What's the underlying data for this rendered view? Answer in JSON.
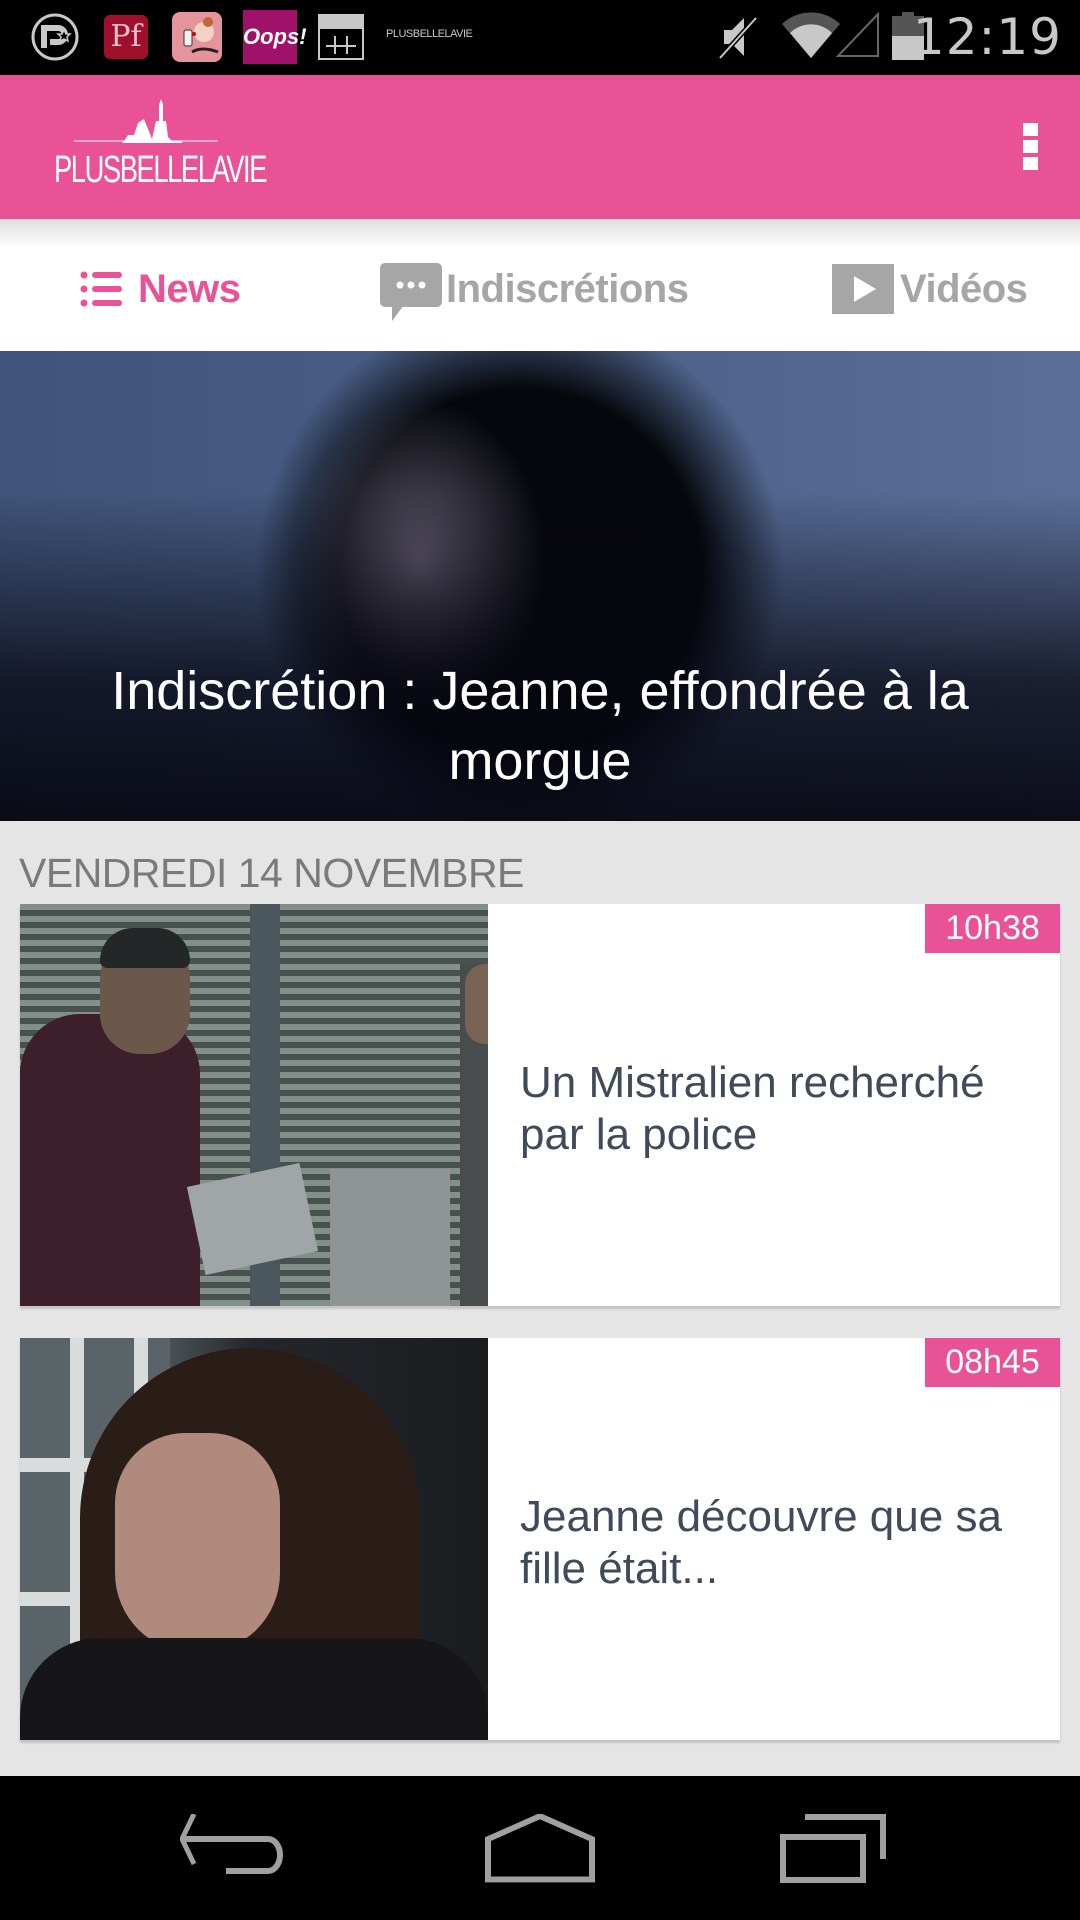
{
  "status_bar": {
    "notification_icons": [
      "pinterest-like-p-icon",
      "pf-app-icon",
      "kiss-app-icon",
      "oops-app-icon",
      "calendar-grid-icon",
      "plusbellelavie-app-icon"
    ],
    "oops_label": "Oops!",
    "pf_label": "Pf",
    "mini_logo_label": "PLUSBELLELAVIE",
    "system_icons": [
      "mute-icon",
      "wifi-icon",
      "cell-signal-icon",
      "battery-icon"
    ],
    "clock": "12:19"
  },
  "app_bar": {
    "logo_text": "PLUSBELLELAVIE",
    "overflow_icon": "more-vert-icon",
    "color": "#ea5297"
  },
  "tabs": [
    {
      "label": "News",
      "icon": "list-icon",
      "active": true
    },
    {
      "label": "Indiscrétions",
      "icon": "chat-bubble-icon",
      "active": false
    },
    {
      "label": "Vidéos",
      "icon": "play-icon",
      "active": false
    }
  ],
  "hero": {
    "title": "Indiscrétion : Jeanne, effondrée à la morgue"
  },
  "feed": {
    "date_label": "VENDREDI 14 NOVEMBRE",
    "items": [
      {
        "time": "10h38",
        "title": "Un Mistralien recherché par la police"
      },
      {
        "time": "08h45",
        "title": "Jeanne découvre que sa fille était..."
      }
    ]
  },
  "nav_bar": {
    "buttons": [
      "back",
      "home",
      "recents"
    ]
  },
  "colors": {
    "accent": "#ea5297",
    "tab_inactive": "#a6a6a6",
    "card_title": "#404a5a",
    "date_label": "#7a7a7a",
    "background": "#e5e5e5"
  }
}
